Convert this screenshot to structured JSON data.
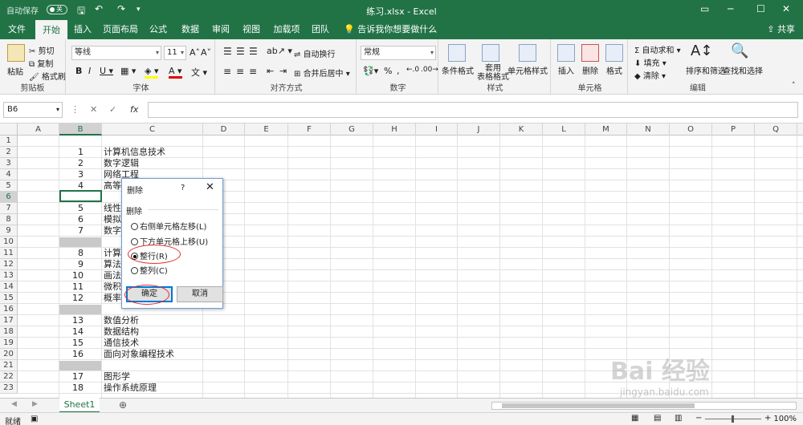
{
  "titlebar": {
    "autosave_label": "自动保存",
    "autosave_state": "关",
    "title": "练习.xlsx  -  Excel"
  },
  "tabs": [
    "文件",
    "开始",
    "插入",
    "页面布局",
    "公式",
    "数据",
    "审阅",
    "视图",
    "加载项",
    "团队"
  ],
  "active_tab": "开始",
  "tellme": "告诉我你想要做什么",
  "share": "共享",
  "ribbon": {
    "clipboard": {
      "paste": "粘贴",
      "cut": "剪切",
      "copy": "复制",
      "format_painter": "格式刷",
      "label": "剪贴板"
    },
    "font": {
      "name": "等线",
      "size": "11",
      "label": "字体"
    },
    "alignment": {
      "wrap": "自动换行",
      "merge": "合并后居中",
      "label": "对齐方式"
    },
    "number": {
      "format": "常规",
      "label": "数字"
    },
    "styles": {
      "conditional": "条件格式",
      "table": "套用\n表格格式",
      "cell_styles": "单元格样式",
      "label": "样式"
    },
    "cells": {
      "insert": "插入",
      "delete": "删除",
      "format": "格式",
      "label": "单元格"
    },
    "editing": {
      "autosum": "自动求和",
      "fill": "填充",
      "clear": "清除",
      "sort": "排序和筛选",
      "find": "查找和选择",
      "label": "编辑"
    }
  },
  "formula_bar": {
    "name_box": "B6",
    "formula": ""
  },
  "columns": [
    "A",
    "B",
    "C",
    "D",
    "E",
    "F",
    "G",
    "H",
    "I",
    "J",
    "K",
    "L",
    "M",
    "N",
    "O",
    "P",
    "Q"
  ],
  "rows": [
    {
      "n": "1",
      "b": "",
      "c": ""
    },
    {
      "n": "2",
      "b": "1",
      "c": "计算机信息技术"
    },
    {
      "n": "3",
      "b": "2",
      "c": "数字逻辑"
    },
    {
      "n": "4",
      "b": "3",
      "c": "网络工程"
    },
    {
      "n": "5",
      "b": "4",
      "c": "高等"
    },
    {
      "n": "6",
      "b": "",
      "c": ""
    },
    {
      "n": "7",
      "b": "5",
      "c": "线性"
    },
    {
      "n": "8",
      "b": "6",
      "c": "模拟"
    },
    {
      "n": "9",
      "b": "7",
      "c": "数字"
    },
    {
      "n": "10",
      "b": "",
      "c": ""
    },
    {
      "n": "11",
      "b": "8",
      "c": "计算"
    },
    {
      "n": "12",
      "b": "9",
      "c": "算法"
    },
    {
      "n": "13",
      "b": "10",
      "c": "画法"
    },
    {
      "n": "14",
      "b": "11",
      "c": "微积"
    },
    {
      "n": "15",
      "b": "12",
      "c": "概率"
    },
    {
      "n": "16",
      "b": "",
      "c": ""
    },
    {
      "n": "17",
      "b": "13",
      "c": "数值分析"
    },
    {
      "n": "18",
      "b": "14",
      "c": "数据结构"
    },
    {
      "n": "19",
      "b": "15",
      "c": "通信技术"
    },
    {
      "n": "20",
      "b": "16",
      "c": "面向对象编程技术"
    },
    {
      "n": "21",
      "b": "",
      "c": ""
    },
    {
      "n": "22",
      "b": "17",
      "c": "图形学"
    },
    {
      "n": "23",
      "b": "18",
      "c": "操作系统原理"
    }
  ],
  "dialog": {
    "title": "删除",
    "help": "?",
    "section": "删除",
    "options": [
      "右侧单元格左移(L)",
      "下方单元格上移(U)",
      "整行(R)",
      "整列(C)"
    ],
    "selected": "整行(R)",
    "ok": "确定",
    "cancel": "取消"
  },
  "sheet_tab": "Sheet1",
  "status": {
    "ready": "就绪",
    "zoom": "100%"
  },
  "watermark": "Bai 经验",
  "watermark_url": "jingyan.baidu.com",
  "colors": {
    "excel_green": "#217346",
    "annotation_red": "#e03030",
    "dialog_blue": "#0078d7"
  }
}
